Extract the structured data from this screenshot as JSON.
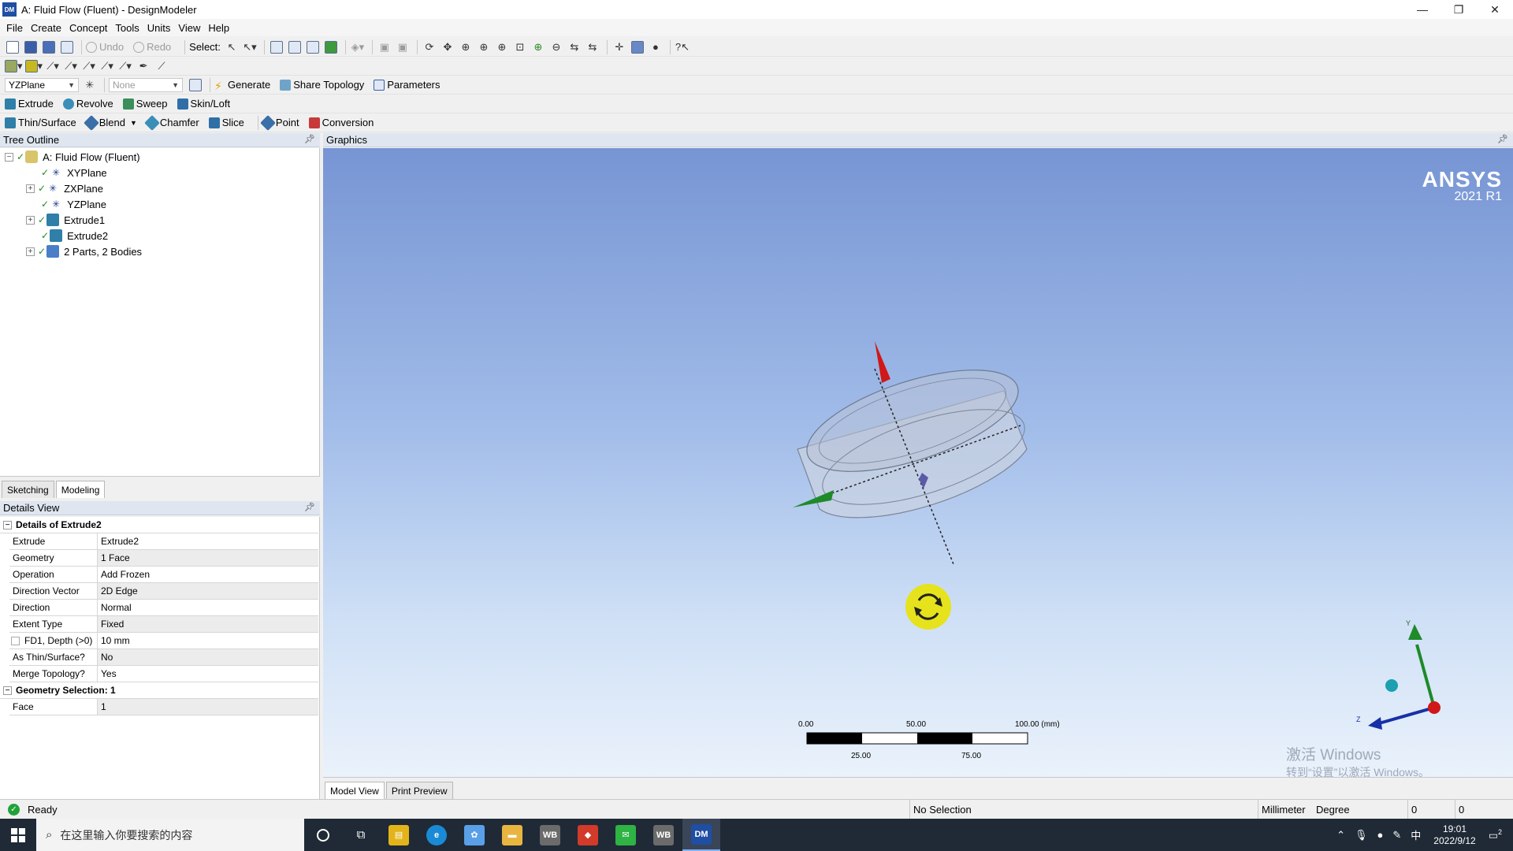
{
  "window": {
    "app_icon": "DM",
    "title": "A: Fluid Flow (Fluent) - DesignModeler",
    "controls": {
      "minimize": "—",
      "restore": "❐",
      "close": "✕"
    }
  },
  "menu": [
    "File",
    "Create",
    "Concept",
    "Tools",
    "Units",
    "View",
    "Help"
  ],
  "toolbar1": {
    "undo": "Undo",
    "redo": "Redo",
    "select_label": "Select:"
  },
  "toolbar3": {
    "plane": "YZPlane",
    "sketch": "None",
    "generate": "Generate",
    "share_topology": "Share Topology",
    "parameters": "Parameters"
  },
  "toolbar4": {
    "extrude": "Extrude",
    "revolve": "Revolve",
    "sweep": "Sweep",
    "skin_loft": "Skin/Loft"
  },
  "toolbar5": {
    "thin_surface": "Thin/Surface",
    "blend": "Blend",
    "chamfer": "Chamfer",
    "slice": "Slice",
    "point": "Point",
    "conversion": "Conversion"
  },
  "tree": {
    "header": "Tree Outline",
    "items": [
      {
        "label": "A: Fluid Flow (Fluent)",
        "icon": "model-icon"
      },
      {
        "label": "XYPlane",
        "icon": "plane-icon"
      },
      {
        "label": "ZXPlane",
        "icon": "plane-icon"
      },
      {
        "label": "YZPlane",
        "icon": "plane-icon"
      },
      {
        "label": "Extrude1",
        "icon": "extrude-icon"
      },
      {
        "label": "Extrude2",
        "icon": "extrude-icon"
      },
      {
        "label": "2 Parts, 2 Bodies",
        "icon": "parts-icon"
      }
    ]
  },
  "mode_tabs": [
    "Sketching",
    "Modeling"
  ],
  "details": {
    "header": "Details View",
    "group1": "Details of Extrude2",
    "rows": [
      {
        "key": "Extrude",
        "value": "Extrude2"
      },
      {
        "key": "Geometry",
        "value": "1 Face"
      },
      {
        "key": "Operation",
        "value": "Add Frozen"
      },
      {
        "key": "Direction Vector",
        "value": "2D Edge"
      },
      {
        "key": "Direction",
        "value": "Normal"
      },
      {
        "key": "Extent Type",
        "value": "Fixed"
      },
      {
        "key": "FD1,  Depth (>0)",
        "value": "10 mm"
      },
      {
        "key": "As Thin/Surface?",
        "value": "No"
      },
      {
        "key": "Merge Topology?",
        "value": "Yes"
      }
    ],
    "group2": "Geometry Selection: 1",
    "rows2": [
      {
        "key": "Face",
        "value": "1"
      }
    ]
  },
  "graphics": {
    "header": "Graphics",
    "logo_line1": "ANSYS",
    "logo_line2": "2021 R1",
    "scale_top": [
      "0.00",
      "50.00",
      "100.00 (mm)"
    ],
    "scale_bottom": [
      "25.00",
      "75.00"
    ],
    "triad_y": "Y",
    "triad_z": "Z",
    "watermark_1": "激活 Windows",
    "watermark_2": "转到“设置”以激活 Windows。"
  },
  "view_tabs": [
    "Model View",
    "Print Preview"
  ],
  "status": {
    "state": "Ready",
    "selection": "No Selection",
    "length_unit": "Millimeter",
    "angle_unit": "Degree",
    "field1": "0",
    "field2": "0"
  },
  "taskbar": {
    "search_placeholder": "在这里输入你要搜索的内容",
    "time": "19:01",
    "date": "2022/9/12",
    "ime": "中",
    "notifications": "2",
    "apps": [
      {
        "name": "explorer-app",
        "label": "▤",
        "color": "#e3b31a"
      },
      {
        "name": "edge-app",
        "label": "e",
        "color": "#1a8ad6"
      },
      {
        "name": "photos-app",
        "label": "✿",
        "color": "#5aa0e8"
      },
      {
        "name": "files-app",
        "label": "▬",
        "color": "#e8b640"
      },
      {
        "name": "workbench-app-1",
        "label": "WB",
        "color": "#6b6b6b"
      },
      {
        "name": "office-app",
        "label": "◆",
        "color": "#d23a2a"
      },
      {
        "name": "wechat-app",
        "label": "✉",
        "color": "#2fb344"
      },
      {
        "name": "workbench-app-2",
        "label": "WB",
        "color": "#6b6b6b"
      },
      {
        "name": "designmodeler-app",
        "label": "DM",
        "color": "#1f4ea3"
      }
    ]
  }
}
